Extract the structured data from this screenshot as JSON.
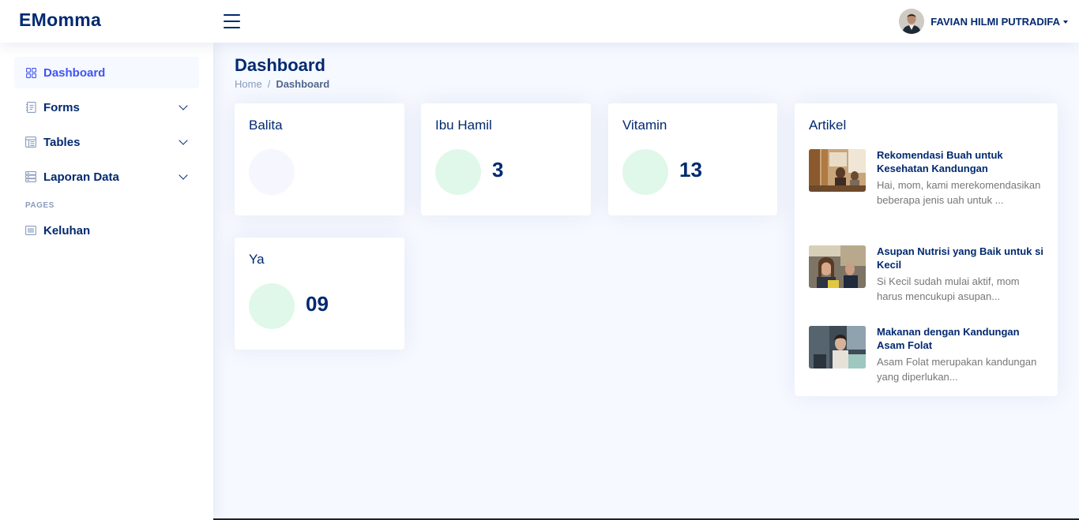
{
  "header": {
    "logo": "EMomma",
    "menu_icon": "hamburger-icon",
    "user_name": "FAVIAN HILMI PUTRADIFA"
  },
  "sidebar": {
    "items": [
      {
        "label": "Dashboard",
        "icon": "grid-icon",
        "active": true
      },
      {
        "label": "Forms",
        "icon": "journal-text-icon",
        "has_submenu": true
      },
      {
        "label": "Tables",
        "icon": "layout-text-window-icon",
        "has_submenu": true
      },
      {
        "label": "Laporan Data",
        "icon": "server-icon",
        "has_submenu": true
      }
    ],
    "pages_heading": "PAGES",
    "pages": [
      {
        "label": "Keluhan",
        "icon": "card-list-icon"
      }
    ]
  },
  "page": {
    "title": "Dashboard",
    "breadcrumb": {
      "home": "Home",
      "separator": "/",
      "current": "Dashboard"
    }
  },
  "cards": [
    {
      "title": "Balita",
      "value": ""
    },
    {
      "title": "Ibu Hamil",
      "value": "3"
    },
    {
      "title": "Vitamin",
      "value": "13"
    },
    {
      "title": "Ya",
      "value": "09"
    }
  ],
  "artikel": {
    "title": "Artikel",
    "items": [
      {
        "heading": "Rekomendasi Buah untuk Kesehatan Kandungan",
        "text": "Hai, mom, kami merekomendasikan beberapa jenis uah untuk ..."
      },
      {
        "heading": "Asupan Nutrisi yang Baik untuk si Kecil",
        "text": "Si Kecil sudah mulai aktif, mom harus mencukupi asupan..."
      },
      {
        "heading": "Makanan dengan Kandungan Asam Folat",
        "text": "Asam Folat merupakan kandungan yang diperlukan..."
      }
    ]
  },
  "colors": {
    "primary": "#012970",
    "accent": "#4154f1",
    "background": "#f6f9ff",
    "circle_blue": "#f6f6fe",
    "circle_green": "#e0f8e9"
  }
}
